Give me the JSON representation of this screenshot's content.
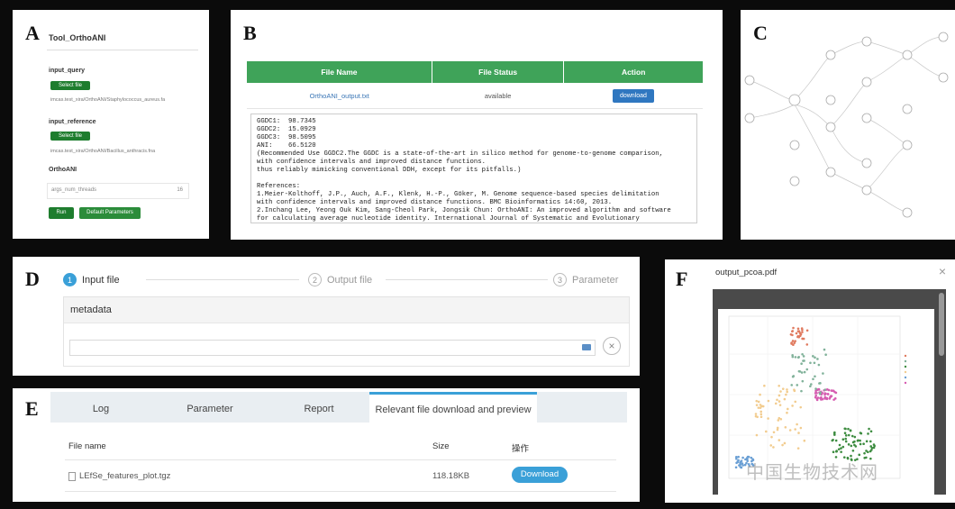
{
  "panelA": {
    "label": "A",
    "title": "Tool_OrthoANI",
    "input_query_label": "input_query",
    "select_file_1": "Select file",
    "path1": "imcas.test_xira/OrthoANI/Staphylococcus_aureus.fa",
    "input_reference_label": "input_reference",
    "select_file_2": "Select file",
    "path2": "imcas.test_xira/OrthoANI/Bacillus_anthracis.fna",
    "orthoani_label": "OrthoANI",
    "param_name": "args_num_threads",
    "param_value": "16",
    "run_button": "Run",
    "default_button": "Default Parameters"
  },
  "panelB": {
    "label": "B",
    "col_name": "File Name",
    "col_status": "File Status",
    "col_action": "Action",
    "file_name": "OrthoANI_output.txt",
    "file_status": "available",
    "action": "download",
    "output_text": "GGDC1:  98.7345\nGGDC2:  15.0929\nGGDC3:  98.5095\nANI:    66.5120\n(Recommended Use GGDC2.The GGDC is a state-of-the-art in silico method for genome-to-genome comparison,\nwith confidence intervals and improved distance functions.\nthus reliably mimicking conventional DDH, except for its pitfalls.)\n\nReferences:\n1.Meier-Kolthoff, J.P., Auch, A.F., Klenk, H.-P., Göker, M. Genome sequence-based species delimitation\nwith confidence intervals and improved distance functions. BMC Bioinformatics 14:60, 2013.\n2.Inchang Lee, Yeong Ouk Kim, Sang-Cheol Park, Jongsik Chun: OrthoANI: An improved algorithm and software\nfor calculating average nucleotide identity. International Journal of Systematic and Evolutionary"
  },
  "panelC": {
    "label": "C"
  },
  "panelD": {
    "label": "D",
    "step1_num": "1",
    "step1": "Input file",
    "step2_num": "2",
    "step2": "Output file",
    "step3_num": "3",
    "step3": "Parameter",
    "section": "metadata",
    "clear_icon": "×"
  },
  "panelE": {
    "label": "E",
    "tabs": [
      "Log",
      "Parameter",
      "Report",
      "Relevant file download and preview"
    ],
    "col_file": "File name",
    "col_size": "Size",
    "col_op": "操作",
    "file": "LEfSe_features_plot.tgz",
    "size": "118.18KB",
    "download": "Download"
  },
  "panelF": {
    "label": "F",
    "title": "output_pcoa.pdf",
    "close": "×"
  },
  "watermark": "中国生物技术网",
  "colors": {
    "green": "#3fa359",
    "blue": "#3aa0d8",
    "dark_green": "#1e7d2e"
  }
}
